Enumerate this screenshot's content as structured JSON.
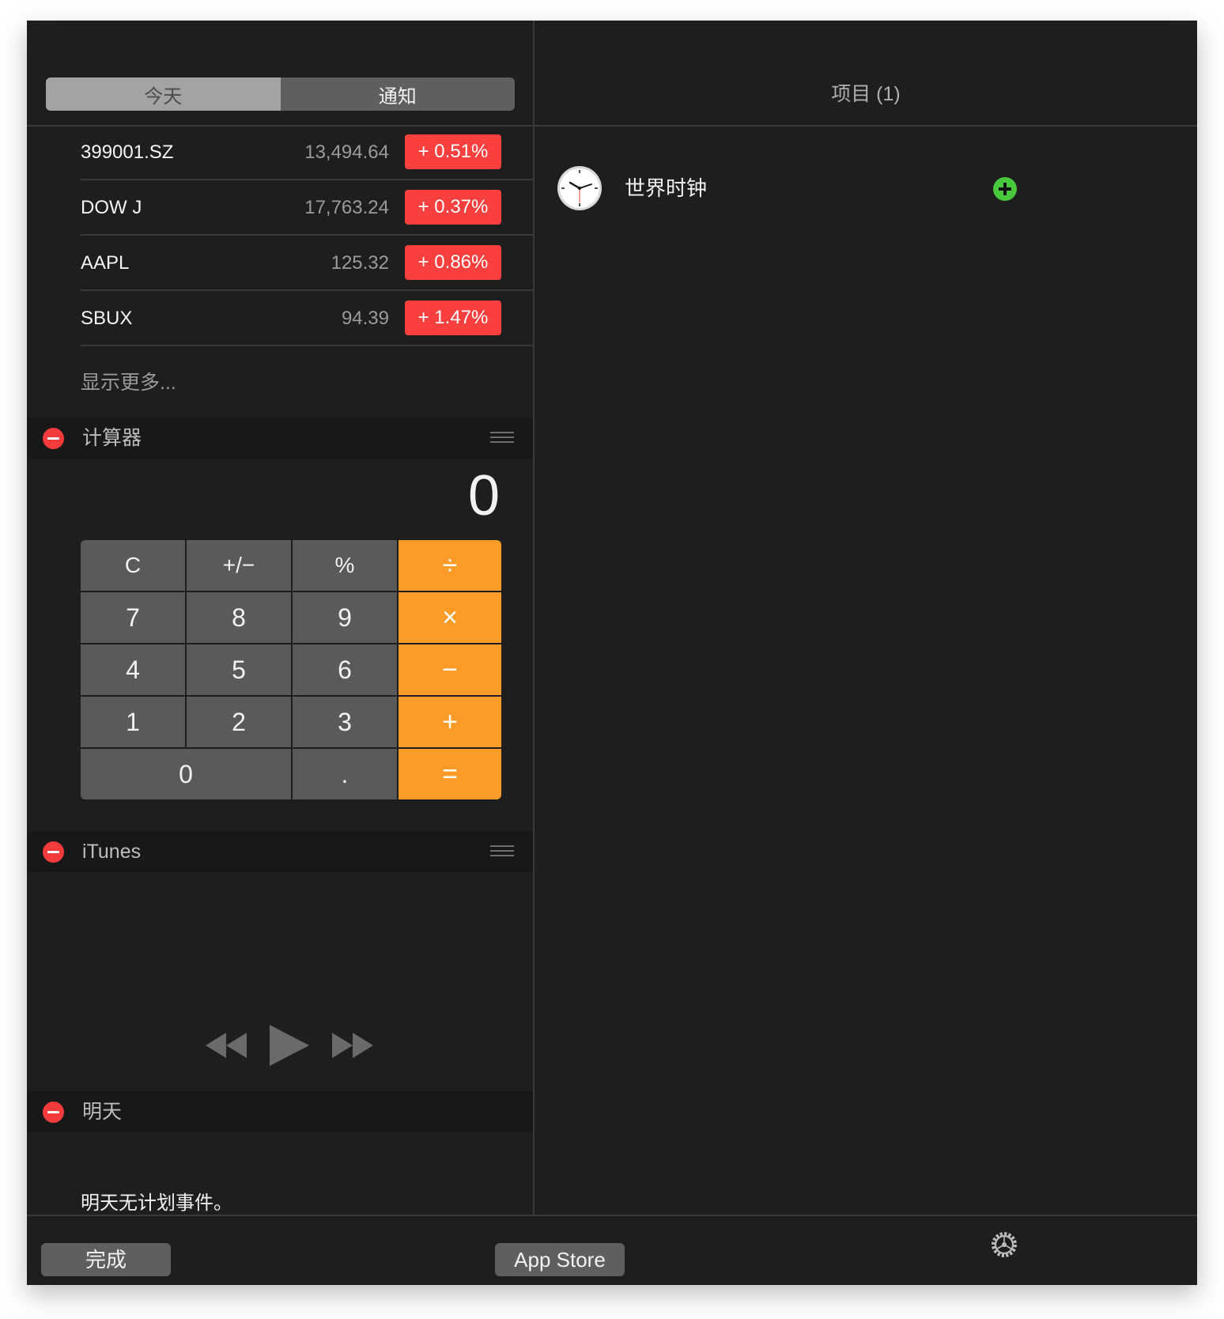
{
  "tabs": {
    "today": "今天",
    "notifications": "通知"
  },
  "stocks": [
    {
      "symbol": "399001.SZ",
      "price": "13,494.64",
      "change": "+ 0.51%"
    },
    {
      "symbol": "DOW J",
      "price": "17,763.24",
      "change": "+ 0.37%"
    },
    {
      "symbol": "AAPL",
      "price": "125.32",
      "change": "+ 0.86%"
    },
    {
      "symbol": "SBUX",
      "price": "94.39",
      "change": "+ 1.47%"
    }
  ],
  "show_more": "显示更多...",
  "calculator": {
    "title": "计算器",
    "display": "0",
    "keys": {
      "c": "C",
      "sign": "+/−",
      "percent": "%",
      "divide": "÷",
      "k7": "7",
      "k8": "8",
      "k9": "9",
      "multiply": "×",
      "k4": "4",
      "k5": "5",
      "k6": "6",
      "minus": "−",
      "k1": "1",
      "k2": "2",
      "k3": "3",
      "plus": "+",
      "k0": "0",
      "dot": ".",
      "equals": "="
    }
  },
  "itunes": {
    "title": "iTunes"
  },
  "tomorrow": {
    "title": "明天",
    "empty_text": "明天无计划事件。"
  },
  "items": {
    "title": "项目 (1)",
    "list": [
      {
        "name": "世界时钟",
        "icon": "clock-icon"
      }
    ]
  },
  "bottom": {
    "done": "完成",
    "app_store": "App Store",
    "settings_icon": "gear-icon"
  },
  "colors": {
    "accent_red": "#f9403e",
    "calc_orange": "#fc9b27",
    "add_green": "#47c93b"
  }
}
